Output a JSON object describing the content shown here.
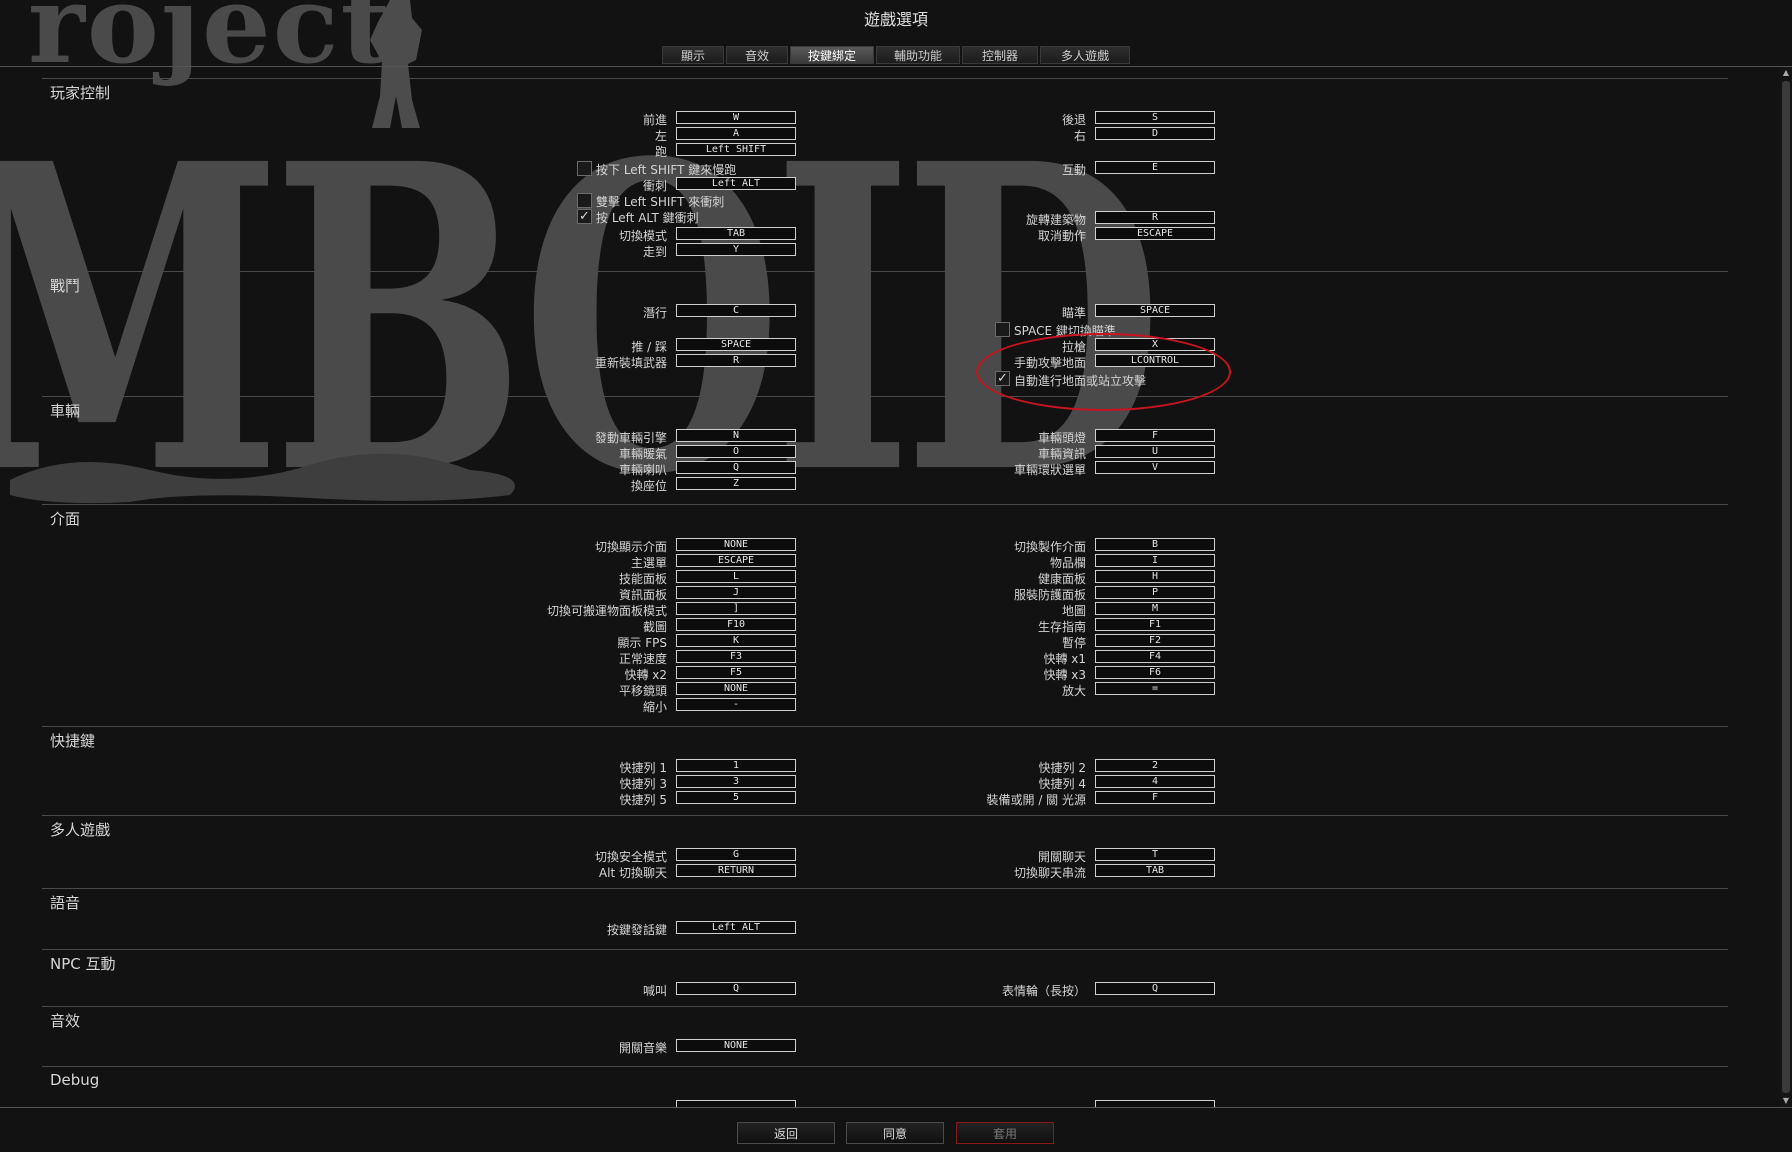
{
  "window": {
    "title": "遊戲選項"
  },
  "logo": {
    "top": "roject",
    "main": "MBOID"
  },
  "tabs": [
    {
      "label": "顯示",
      "active": false
    },
    {
      "label": "音效",
      "active": false
    },
    {
      "label": "按鍵綁定",
      "active": true
    },
    {
      "label": "輔助功能",
      "active": false
    },
    {
      "label": "控制器",
      "active": false
    },
    {
      "label": "多人遊戲",
      "active": false
    }
  ],
  "sections": {
    "player": {
      "title": "玩家控制",
      "bindings": [
        {
          "label": "前進",
          "key": "W"
        },
        {
          "label": "後退",
          "key": "S"
        },
        {
          "label": "左",
          "key": "A"
        },
        {
          "label": "右",
          "key": "D"
        },
        {
          "label": "跑",
          "key": "Left SHIFT"
        },
        {
          "label": "衝刺",
          "key": "Left ALT"
        },
        {
          "label": "互動",
          "key": "E"
        },
        {
          "label": "旋轉建築物",
          "key": "R"
        },
        {
          "label": "切換模式",
          "key": "TAB"
        },
        {
          "label": "取消動作",
          "key": "ESCAPE"
        },
        {
          "label": "走到",
          "key": "Y"
        }
      ],
      "checkboxes": [
        {
          "label": "按下 Left SHIFT 鍵來慢跑",
          "checked": false
        },
        {
          "label": "雙擊 Left SHIFT 來衝刺",
          "checked": false
        },
        {
          "label": "按 Left ALT 鍵衝刺",
          "checked": true
        }
      ]
    },
    "combat": {
      "title": "戰鬥",
      "bindings": [
        {
          "label": "潛行",
          "key": "C"
        },
        {
          "label": "瞄準",
          "key": "SPACE"
        },
        {
          "label": "推 / 踩",
          "key": "SPACE"
        },
        {
          "label": "拉槍",
          "key": "X"
        },
        {
          "label": "重新裝填武器",
          "key": "R"
        },
        {
          "label": "手動攻擊地面",
          "key": "LCONTROL"
        }
      ],
      "checkboxes": [
        {
          "label": "SPACE 鍵切換瞄準",
          "checked": false
        },
        {
          "label": "自動進行地面或站立攻擊",
          "checked": true
        }
      ]
    },
    "vehicle": {
      "title": "車輛",
      "bindings": [
        {
          "label": "發動車輛引擎",
          "key": "N"
        },
        {
          "label": "車輛頭燈",
          "key": "F"
        },
        {
          "label": "車輛暖氣",
          "key": "O"
        },
        {
          "label": "車輛資訊",
          "key": "U"
        },
        {
          "label": "車輛喇叭",
          "key": "Q"
        },
        {
          "label": "車輛環狀選單",
          "key": "V"
        },
        {
          "label": "換座位",
          "key": "Z"
        }
      ]
    },
    "ui": {
      "title": "介面",
      "bindings": [
        {
          "label": "切換顯示介面",
          "key": "NONE"
        },
        {
          "label": "切換製作介面",
          "key": "B"
        },
        {
          "label": "主選單",
          "key": "ESCAPE"
        },
        {
          "label": "物品欄",
          "key": "I"
        },
        {
          "label": "技能面板",
          "key": "L"
        },
        {
          "label": "健康面板",
          "key": "H"
        },
        {
          "label": "資訊面板",
          "key": "J"
        },
        {
          "label": "服裝防護面板",
          "key": "P"
        },
        {
          "label": "切換可搬運物面板模式",
          "key": "]"
        },
        {
          "label": "地圖",
          "key": "M"
        },
        {
          "label": "截圖",
          "key": "F10"
        },
        {
          "label": "生存指南",
          "key": "F1"
        },
        {
          "label": "顯示 FPS",
          "key": "K"
        },
        {
          "label": "暫停",
          "key": "F2"
        },
        {
          "label": "正常速度",
          "key": "F3"
        },
        {
          "label": "快轉 x1",
          "key": "F4"
        },
        {
          "label": "快轉 x2",
          "key": "F5"
        },
        {
          "label": "快轉 x3",
          "key": "F6"
        },
        {
          "label": "平移鏡頭",
          "key": "NONE"
        },
        {
          "label": "放大",
          "key": "="
        },
        {
          "label": "縮小",
          "key": "-"
        }
      ]
    },
    "hotkeys": {
      "title": "快捷鍵",
      "bindings": [
        {
          "label": "快捷列 1",
          "key": "1"
        },
        {
          "label": "快捷列 2",
          "key": "2"
        },
        {
          "label": "快捷列 3",
          "key": "3"
        },
        {
          "label": "快捷列 4",
          "key": "4"
        },
        {
          "label": "快捷列 5",
          "key": "5"
        },
        {
          "label": "裝備或開 / 關 光源",
          "key": "F"
        }
      ]
    },
    "multiplayer": {
      "title": "多人遊戲",
      "bindings": [
        {
          "label": "切換安全模式",
          "key": "G"
        },
        {
          "label": "開關聊天",
          "key": "T"
        },
        {
          "label": "Alt 切換聊天",
          "key": "RETURN"
        },
        {
          "label": "切換聊天串流",
          "key": "TAB"
        }
      ]
    },
    "voice": {
      "title": "語音",
      "bindings": [
        {
          "label": "按鍵發話鍵",
          "key": "Left ALT"
        }
      ]
    },
    "npc": {
      "title": "NPC 互動",
      "bindings": [
        {
          "label": "喊叫",
          "key": "Q"
        },
        {
          "label": "表情輪（長按）",
          "key": "Q"
        }
      ]
    },
    "sound": {
      "title": "音效",
      "bindings": [
        {
          "label": "開關音樂",
          "key": "NONE"
        }
      ]
    },
    "debug": {
      "title": "Debug"
    }
  },
  "buttons": {
    "back": "返回",
    "accept": "同意",
    "apply": "套用"
  },
  "colors": {
    "background": "#121212",
    "annotation_circle": "#c8141e",
    "logo": "#4a4a4a"
  }
}
